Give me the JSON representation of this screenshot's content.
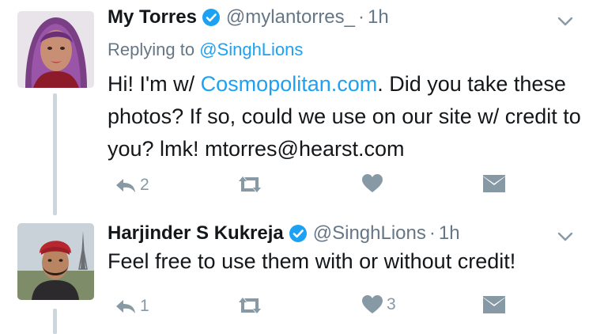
{
  "tweets": [
    {
      "display_name": "My Torres",
      "handle": "@mylantorres_",
      "dot": "·",
      "time": "1h",
      "replying_prefix": "Replying to",
      "replying_to": "@SinghLions",
      "text_before_link": "Hi! I'm w/ ",
      "link": "Cosmopolitan.com",
      "text_after_link": ". Did you take these photos? If so, could we use on our site w/ credit to you? lmk! mtorres@hearst.com",
      "actions": {
        "reply_count": "2",
        "retweet_count": "",
        "like_count": ""
      }
    },
    {
      "display_name": "Harjinder S Kukreja",
      "handle": "@SinghLions",
      "dot": "·",
      "time": "1h",
      "text": "Feel free to use them with or without credit!",
      "actions": {
        "reply_count": "1",
        "retweet_count": "",
        "like_count": "3"
      }
    }
  ],
  "colors": {
    "name": "#14171a",
    "meta": "#657786",
    "link": "#1da1f2",
    "verified": "#1da1f2",
    "action": "#8899a6",
    "thread_line": "#ccd6dd"
  },
  "icons": [
    "verified-icon",
    "caret-down-icon",
    "reply-icon",
    "retweet-icon",
    "heart-icon",
    "direct-message-icon"
  ]
}
